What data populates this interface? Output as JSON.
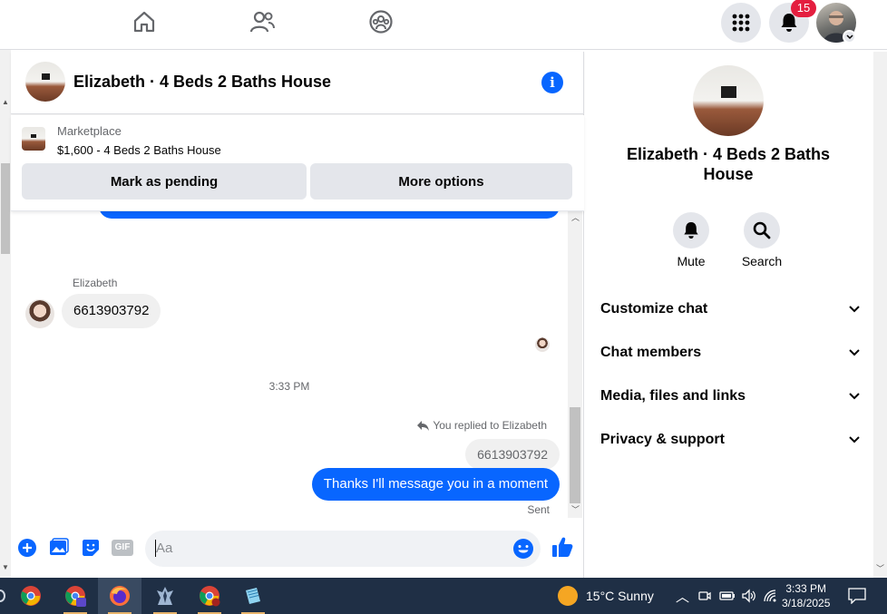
{
  "topnav": {
    "notification_count": "15",
    "icons": [
      "home-icon",
      "friends-icon",
      "groups-icon",
      "menu-grid-icon",
      "bell-icon"
    ]
  },
  "chat": {
    "title": "Elizabeth · 4 Beds 2 Baths House",
    "marketplace": {
      "label": "Marketplace",
      "listing": "$1,600 - 4 Beds 2 Baths House",
      "mark_pending": "Mark as pending",
      "more_options": "More options"
    },
    "messages": {
      "sender_name": "Elizabeth",
      "incoming_text": "6613903792",
      "time_separator": "3:33 PM",
      "reply_note": "You replied to Elizabeth",
      "quoted_text": "6613903792",
      "outgoing_text": "Thanks I'll message you in a moment",
      "status": "Sent"
    },
    "composer": {
      "placeholder": "Aa",
      "gif_label": "GIF"
    }
  },
  "right_panel": {
    "title": "Elizabeth · 4 Beds 2 Baths House",
    "actions": [
      {
        "label": "Mute",
        "icon": "bell-icon"
      },
      {
        "label": "Search",
        "icon": "search-icon"
      }
    ],
    "sections": [
      "Customize chat",
      "Chat members",
      "Media, files and links",
      "Privacy & support"
    ]
  },
  "taskbar": {
    "weather": "15°C  Sunny",
    "time": "3:33 PM",
    "date": "3/18/2025",
    "apps": [
      "chrome-icon",
      "chrome-profile-icon",
      "firefox-icon",
      "game-icon",
      "chrome-alt-icon",
      "notepad-icon"
    ]
  },
  "colors": {
    "accent": "#0866ff",
    "badge": "#e41e3f",
    "taskbar": "#1f2f45"
  }
}
